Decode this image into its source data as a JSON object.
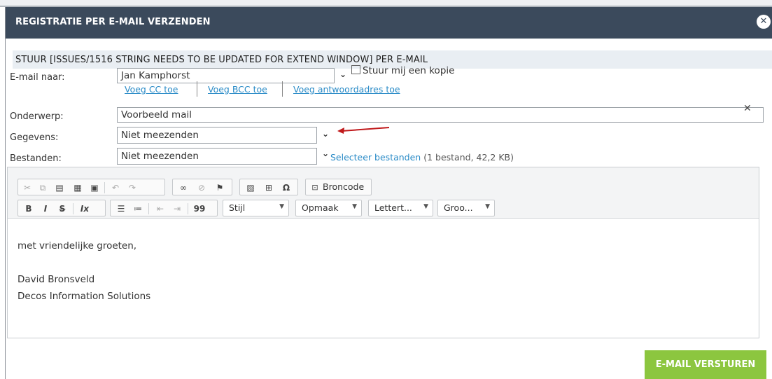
{
  "dialog": {
    "title": "REGISTRATIE PER E-MAIL VERZENDEN",
    "close_icon": "close-icon"
  },
  "subject_header": "STUUR [ISSUES/1516 STRING NEEDS TO BE UPDATED FOR EXTEND WINDOW] PER E-MAIL",
  "form": {
    "to_label": "E-mail naar:",
    "to_value": "Jan Kamphorst",
    "copy_label": "Stuur mij een kopie",
    "links": {
      "cc": "Voeg CC toe",
      "bcc": "Voeg BCC toe",
      "reply": "Voeg antwoordadres toe"
    },
    "subject_label": "Onderwerp:",
    "subject_value": "Voorbeeld mail",
    "data_label": "Gegevens:",
    "data_value": "Niet meezenden",
    "files_label": "Bestanden:",
    "files_value": "Niet meezenden",
    "select_files": "Selecteer bestanden",
    "files_meta": "(1 bestand, 42,2 KB)"
  },
  "toolbar": {
    "source_label": "Broncode",
    "style_label": "Stijl",
    "format_label": "Opmaak",
    "font_label": "Lettert...",
    "size_label": "Groo...",
    "bold": "B",
    "italic": "I",
    "strike": "S",
    "quote": "99",
    "special_char": "Ω"
  },
  "body": {
    "line1": "met vriendelijke groeten,",
    "line2": "David Bronsveld",
    "line3": "Decos Information Solutions"
  },
  "send_label": "E-MAIL VERSTUREN",
  "colors": {
    "titlebar": "#3b4a5c",
    "link": "#2a8bc7",
    "send": "#8cc63f",
    "arrow": "#c0191b"
  }
}
